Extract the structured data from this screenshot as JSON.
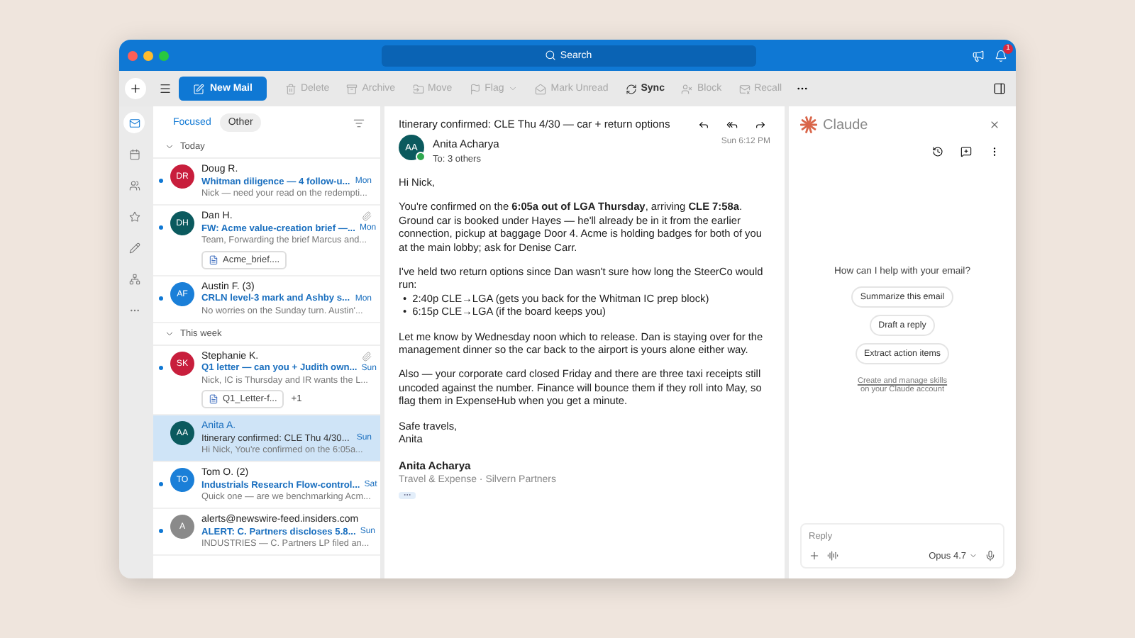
{
  "window": {
    "search_placeholder": "Search",
    "notification_count": "1"
  },
  "toolbar": {
    "new_mail": "New Mail",
    "actions": [
      {
        "kind": "delete",
        "label": "Delete",
        "disabled": true
      },
      {
        "kind": "archive",
        "label": "Archive",
        "disabled": true
      },
      {
        "kind": "move",
        "label": "Move",
        "disabled": true
      },
      {
        "kind": "flag",
        "label": "Flag",
        "disabled": true
      },
      {
        "kind": "unread",
        "label": "Mark Unread",
        "disabled": true
      },
      {
        "kind": "sync",
        "label": "Sync",
        "disabled": false
      },
      {
        "kind": "block",
        "label": "Block",
        "disabled": true
      },
      {
        "kind": "recall",
        "label": "Recall",
        "disabled": true
      }
    ]
  },
  "nav_rail": [
    {
      "kind": "mail",
      "selected": true
    },
    {
      "kind": "calendar",
      "selected": false
    },
    {
      "kind": "people",
      "selected": false
    },
    {
      "kind": "favorites",
      "selected": false
    },
    {
      "kind": "tasks",
      "selected": false
    },
    {
      "kind": "apps",
      "selected": false
    },
    {
      "kind": "more",
      "selected": false
    }
  ],
  "message_list": {
    "tabs": [
      {
        "label": "Focused",
        "selected": true
      },
      {
        "label": "Other",
        "selected": false
      }
    ],
    "groups": [
      {
        "label": "Today",
        "messages": [
          {
            "initials": "DR",
            "color": "#c81e3c",
            "sender": "Doug R.",
            "subject": "Whitman diligence — 4 follow-u...",
            "preview": "Nick — need your read on the redempti...",
            "time": "Mon",
            "unread": true,
            "selected": false,
            "attachment": false
          },
          {
            "initials": "DH",
            "color": "#0b5a5e",
            "sender": "Dan H.",
            "subject": "FW: Acme value-creation brief —...",
            "preview": "Team, Forwarding the brief Marcus and...",
            "time": "Mon",
            "unread": true,
            "selected": false,
            "attachment": true,
            "file": {
              "name": "Acme_brief...."
            }
          },
          {
            "initials": "AF",
            "color": "#1a7fd8",
            "sender": "Austin F. (3)",
            "subject": "CRLN level-3 mark and Ashby s...",
            "preview": "No worries on the Sunday turn. Austin'...",
            "time": "Mon",
            "unread": true,
            "selected": false,
            "attachment": false
          }
        ]
      },
      {
        "label": "This week",
        "messages": [
          {
            "initials": "SK",
            "color": "#c81e3c",
            "sender": "Stephanie K.",
            "subject": "Q1 letter — can you + Judith own...",
            "preview": "Nick, IC is Thursday and IR wants the L...",
            "time": "Sun",
            "unread": true,
            "selected": false,
            "attachment": true,
            "file": {
              "name": "Q1_Letter-f...",
              "extra": "+1"
            }
          },
          {
            "initials": "AA",
            "color": "#0b5a5e",
            "sender": "Anita A.",
            "subject": "Itinerary confirmed: CLE Thu 4/30...",
            "preview": "Hi Nick, You're confirmed on the 6:05a...",
            "time": "Sun",
            "unread": false,
            "selected": true,
            "attachment": false
          },
          {
            "initials": "TO",
            "color": "#1a7fd8",
            "sender": "Tom O. (2)",
            "subject": "Industrials Research Flow-control...",
            "preview": "Quick one — are we benchmarking Acm...",
            "time": "Sat",
            "unread": true,
            "selected": false,
            "attachment": false
          },
          {
            "initials": "A",
            "color": "#8a8a8a",
            "sender": "alerts@newswire-feed.insiders.com",
            "subject": "ALERT: C. Partners discloses 5.8...",
            "preview": "INDUSTRIES — C. Partners LP filed an...",
            "time": "Sun",
            "unread": true,
            "selected": false,
            "attachment": false
          }
        ]
      }
    ]
  },
  "reading": {
    "subject": "Itinerary confirmed: CLE Thu 4/30 — car + return options",
    "initials": "AA",
    "sender": "Anita Acharya",
    "online": true,
    "to": "To: 3 others",
    "time": "Sun 6:12 PM",
    "body": [
      {
        "text": "Hi Nick,"
      },
      {
        "text": "You're confirmed on the **6:05a out of LGA Thursday**, arriving **CLE 7:58a**. Ground car is booked under Hayes — he'll already be in it from the earlier connection, pickup at baggage Door 4. Acme is holding badges for both of you at the main lobby; ask for Denise Carr."
      },
      {
        "text": "I've held two return options since Dan wasn't sure how long the SteerCo would run:",
        "bullets": [
          {
            "marker": "•",
            "text": "2:40p CLE→LGA (gets you back for the Whitman IC prep block)"
          },
          {
            "marker": "•",
            "text": "6:15p CLE→LGA (if the board keeps you)"
          }
        ]
      },
      {
        "text": "Let me know by Wednesday noon which to release. Dan is staying over for the management dinner so the car back to the airport is yours alone either way."
      },
      {
        "text": "Also — your corporate card closed Friday and there are three taxi receipts still uncoded against the number. Finance will bounce them if they roll into May, so flag them in ExpenseHub when you get a minute."
      },
      {
        "text": "Safe travels,\nAnita"
      }
    ],
    "signature": {
      "name": "Anita Acharya",
      "title": "Travel & Expense · Silvern Partners"
    }
  },
  "assistant": {
    "title": "Claude",
    "prompt": "How can I help with your email?",
    "suggestions": [
      "Summarize this email",
      "Draft a reply",
      "Extract action items"
    ],
    "skills_link": "Create and manage skills",
    "skills_note": "on your Claude account",
    "reply_placeholder": "Reply",
    "model": "Opus 4.7"
  }
}
